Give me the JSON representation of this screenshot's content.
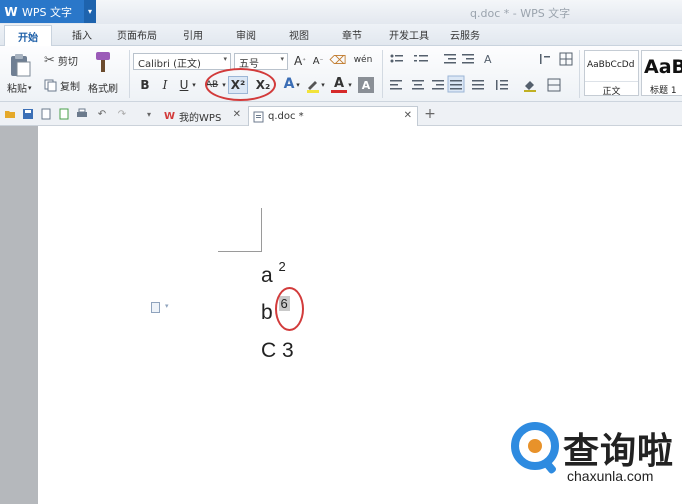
{
  "window": {
    "app_button": "WPS 文字",
    "title": "q.doc * - WPS 文字"
  },
  "menu": {
    "tabs": [
      "开始",
      "插入",
      "页面布局",
      "引用",
      "审阅",
      "视图",
      "章节",
      "开发工具",
      "云服务"
    ]
  },
  "ribbon": {
    "paste_label": "粘贴",
    "cut_label": "剪切",
    "copy_label": "复制",
    "format_painter_label": "格式刷",
    "font_name": "Calibri (正文)",
    "font_size": "五号",
    "bold": "B",
    "italic": "I",
    "underline": "U",
    "strikethrough": "AB",
    "superscript": "X²",
    "subscript": "X₂",
    "style_normal_preview": "AaBbCcDd",
    "style_normal_label": "正文",
    "style_heading_preview": "AaB",
    "style_heading_label": "标题 1"
  },
  "tabstrip": {
    "tabs": [
      {
        "label": "我的WPS"
      },
      {
        "label": "q.doc *"
      }
    ],
    "add_label": "+"
  },
  "document": {
    "line1_base": "a",
    "line1_sup": "2",
    "line2_base": "b",
    "line2_sup": "6",
    "line3": "C 3"
  },
  "watermark": {
    "text_cn": "查询啦",
    "text_en": "chaxunla.com"
  },
  "colors": {
    "accent": "#2a77c9",
    "annotation": "#d23b3b",
    "watermark_blue": "#2e8be0"
  }
}
